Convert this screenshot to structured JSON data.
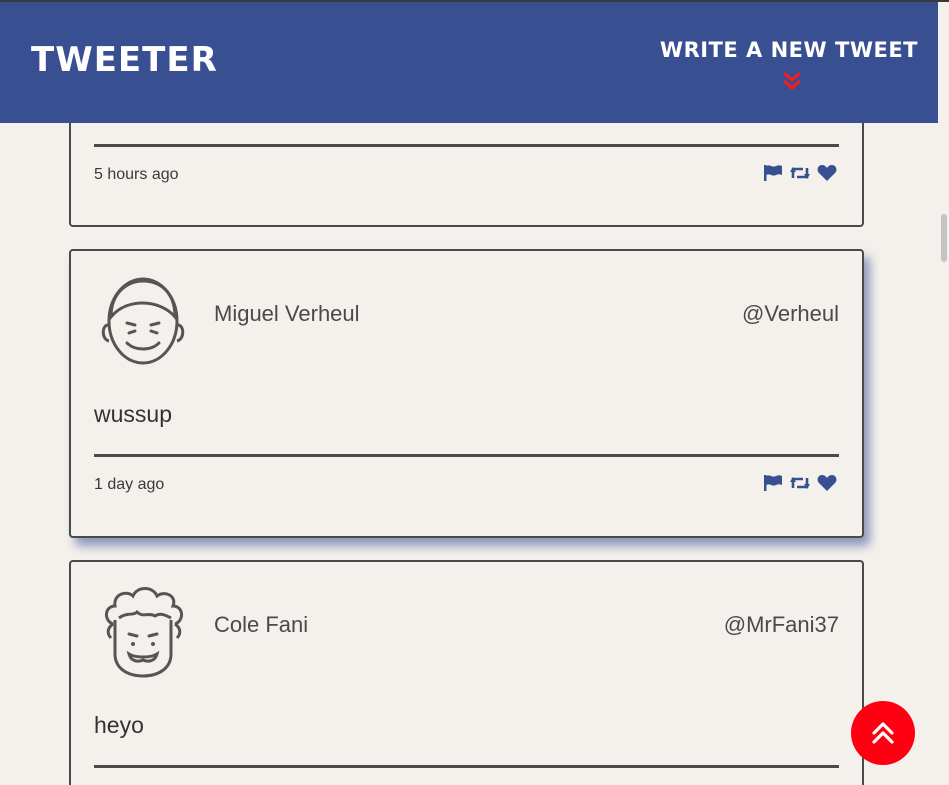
{
  "header": {
    "brand": "TWEETER",
    "write_label": "WRITE A NEW TWEET",
    "write_icon": "double-chevron-down-icon"
  },
  "colors": {
    "nav_bg": "#384f92",
    "page_bg": "#f4f1ec",
    "accent_red": "#ff0012",
    "icon_blue": "#384f92"
  },
  "tweets": [
    {
      "name": "",
      "handle": "",
      "content": "",
      "time": "5 hours ago"
    },
    {
      "name": "Miguel Verheul",
      "handle": "@Verheul",
      "content": "wussup",
      "time": "1 day ago"
    },
    {
      "name": "Cole Fani",
      "handle": "@MrFani37",
      "content": "heyo",
      "time": ""
    }
  ],
  "actions": [
    "flag-icon",
    "retweet-icon",
    "heart-icon"
  ],
  "scroll_top_icon": "double-chevron-up-icon"
}
